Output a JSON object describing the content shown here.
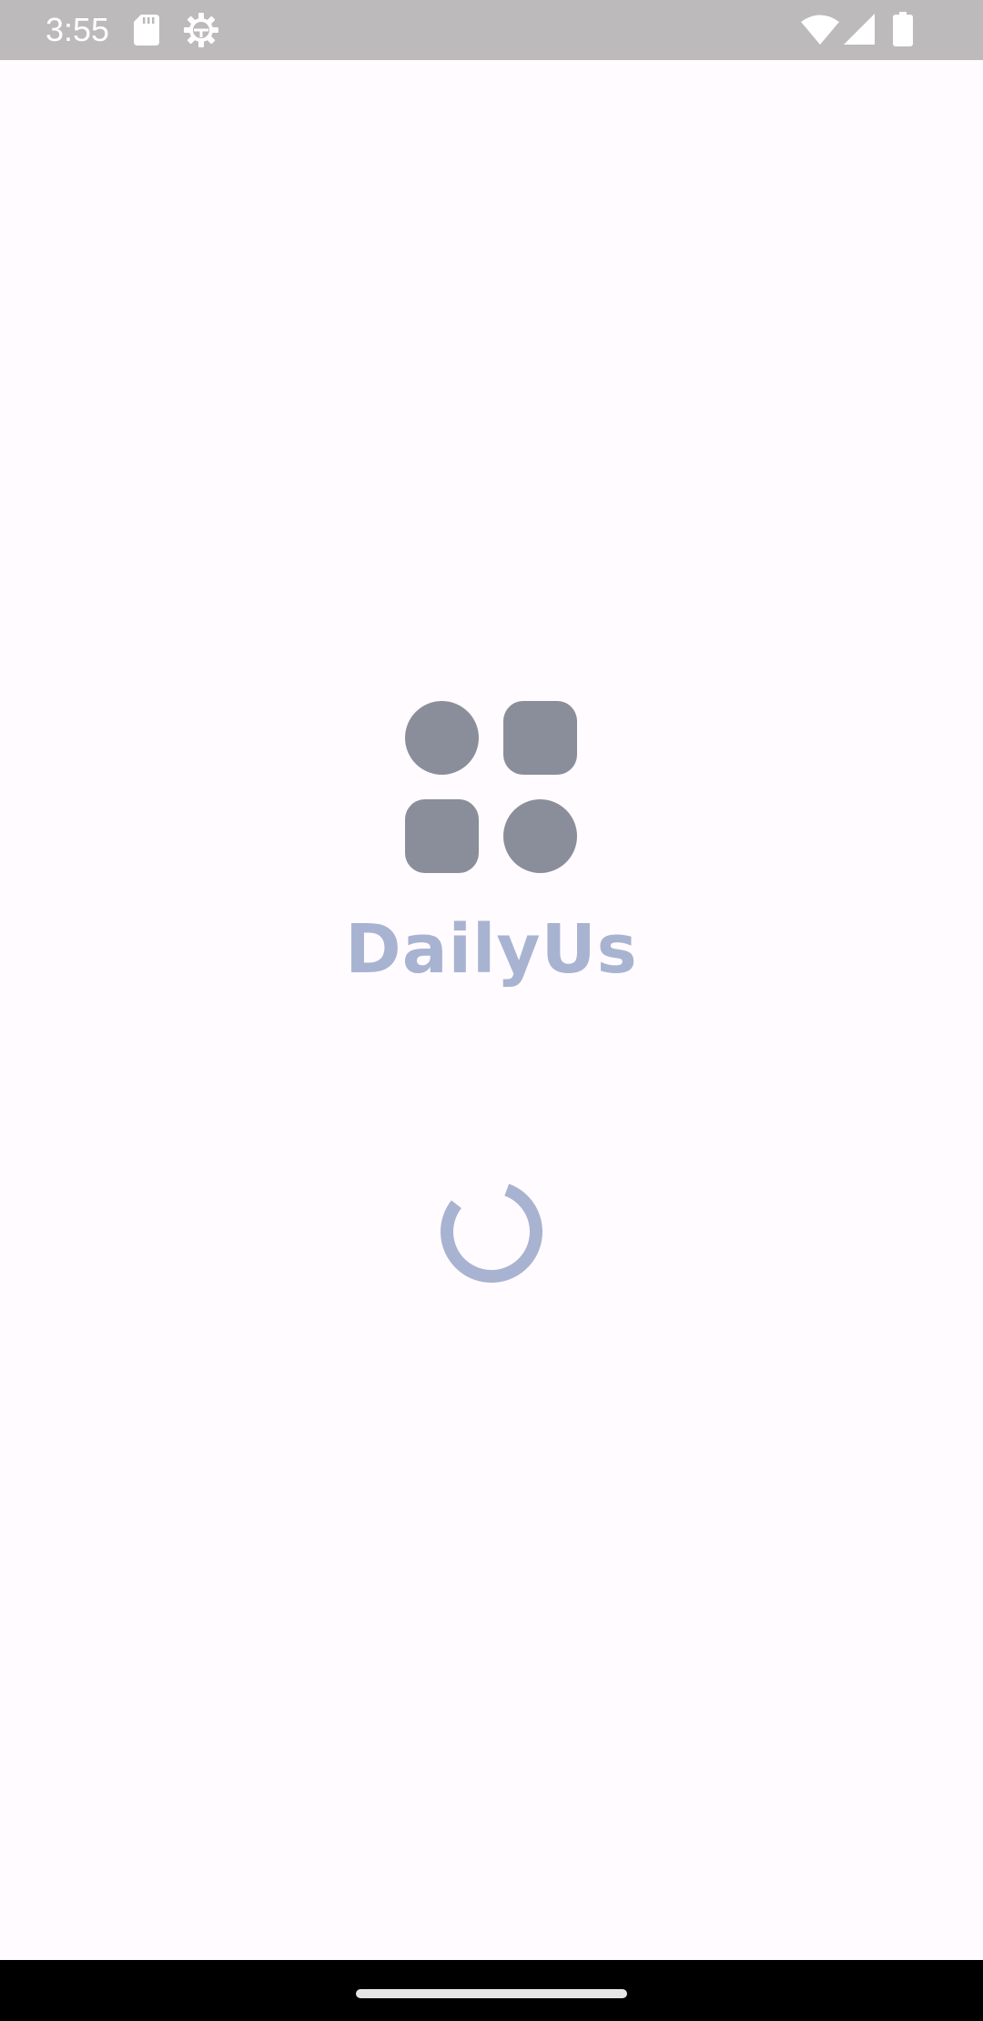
{
  "status_bar": {
    "time": "3:55",
    "icons": [
      "sd-card-icon",
      "settings-gear-icon",
      "wifi-icon",
      "cell-signal-icon",
      "battery-icon"
    ]
  },
  "splash": {
    "app_name": "DailyUs",
    "logo_icon": "four-shapes-grid-icon",
    "loading_indicator": "circular-progress-icon"
  },
  "colors": {
    "status_bar_bg": "#bcbabb",
    "background": "#fffbfe",
    "logo_shape": "#8a8e9a",
    "brand_text": "#a8b3d1",
    "spinner": "#a8b3d1",
    "nav_bar_bg": "#000000"
  },
  "navigation": {
    "home_handle": "gesture-home-handle"
  }
}
